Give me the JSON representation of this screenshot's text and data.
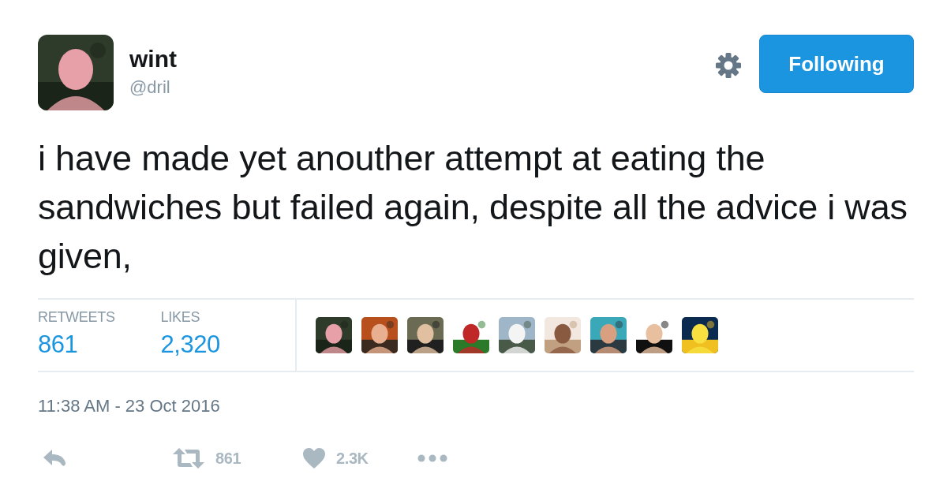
{
  "author": {
    "name": "wint",
    "handle": "@dril"
  },
  "follow_button": {
    "label": "Following",
    "selected": true
  },
  "tweet": {
    "text": "i have made yet anouther attempt at eating the sandwiches but failed again, despite all the advice i was given,"
  },
  "stats": [
    {
      "label": "RETWEETS",
      "value": "861"
    },
    {
      "label": "LIKES",
      "value": "2,320"
    }
  ],
  "timestamp": "11:38 AM - 23 Oct 2016",
  "actions": [
    {
      "kind": "reply"
    },
    {
      "kind": "retweet",
      "count": "861"
    },
    {
      "kind": "like",
      "count": "2.3K"
    },
    {
      "kind": "more"
    }
  ]
}
